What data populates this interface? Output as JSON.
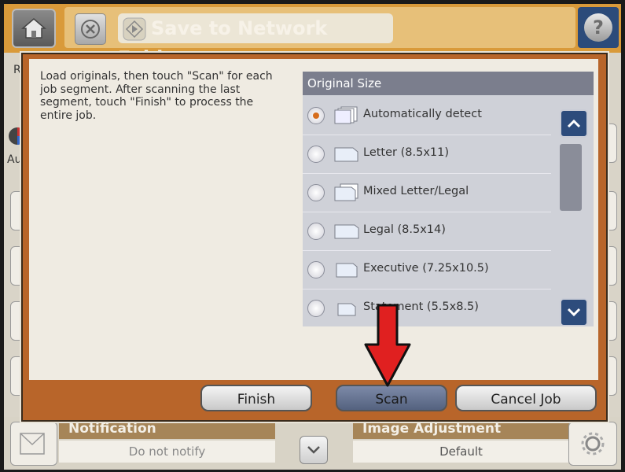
{
  "topbar": {
    "title": "Save to Network Folder",
    "icons": {
      "home": "home-icon",
      "stop": "stop-icon",
      "start": "start-icon",
      "help": "help-icon"
    },
    "help_label": "?"
  },
  "background": {
    "left_fragment_top": "Re",
    "left_fragment_mid": "Aut"
  },
  "dialog": {
    "instructions": "Load originals, then touch \"Scan\" for each job segment. After scanning the last segment, touch \"Finish\" to process the entire job.",
    "original_size": {
      "header": "Original Size",
      "options": [
        {
          "label": "Automatically detect",
          "selected": true
        },
        {
          "label": "Letter (8.5x11)",
          "selected": false
        },
        {
          "label": "Mixed Letter/Legal",
          "selected": false
        },
        {
          "label": "Legal (8.5x14)",
          "selected": false
        },
        {
          "label": "Executive (7.25x10.5)",
          "selected": false
        },
        {
          "label": "Statement (5.5x8.5)",
          "selected": false
        }
      ]
    },
    "buttons": {
      "finish": "Finish",
      "scan": "Scan",
      "cancel": "Cancel Job"
    }
  },
  "bottom": {
    "notification": {
      "label": "Notification",
      "value": "Do not notify"
    },
    "image_adjustment": {
      "label": "Image Adjustment",
      "value": "Default"
    }
  },
  "colors": {
    "accent": "#d99a3a",
    "dialog_frame": "#b8652a",
    "header": "#7b7e8d",
    "nav_blue": "#2d4c7c",
    "selected_radio": "#d66e1e",
    "annotation_arrow": "#e02020"
  }
}
